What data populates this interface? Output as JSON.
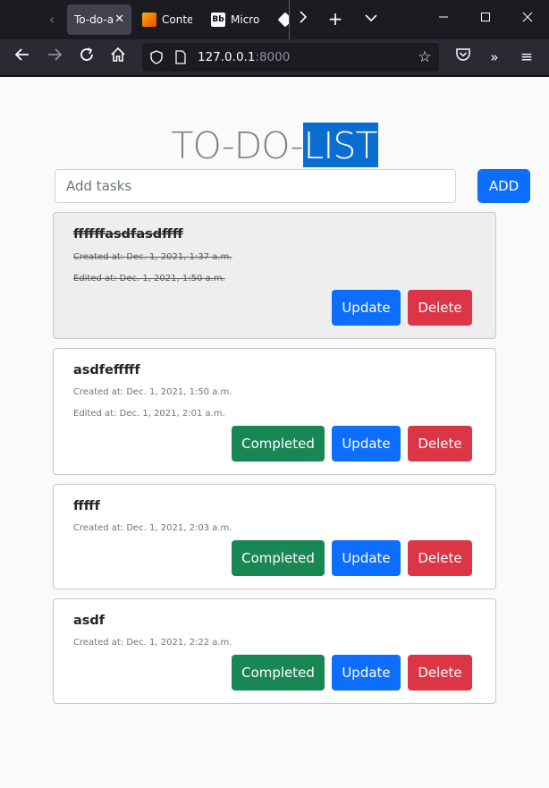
{
  "browser": {
    "tabs": [
      {
        "title": "To-do-a",
        "active": true
      },
      {
        "title": "Conte",
        "active": false
      },
      {
        "title": "Micro",
        "active": false
      },
      {
        "title": "",
        "active": false
      }
    ],
    "window_controls": {
      "minimize": "—",
      "maximize": "☐",
      "close": "✕"
    },
    "url_host": "127.0.0.1",
    "url_port": ":8000"
  },
  "page": {
    "title_plain": "TO-DO-",
    "title_selected": "LIST",
    "input_placeholder": "Add tasks",
    "add_label": "ADD"
  },
  "tasks": [
    {
      "title": "ffffffasdfasdffff",
      "created": "Created at: Dec. 1, 2021, 1:37 a.m.",
      "edited": "Edited at: Dec. 1, 2021, 1:50 a.m.",
      "completed": true,
      "update_label": "Update",
      "delete_label": "Delete"
    },
    {
      "title": "asdfefffff",
      "created": "Created at: Dec. 1, 2021, 1:50 a.m.",
      "edited": "Edited at: Dec. 1, 2021, 2:01 a.m.",
      "completed": false,
      "completed_label": "Completed",
      "update_label": "Update",
      "delete_label": "Delete"
    },
    {
      "title": "fffff",
      "created": "Created at: Dec. 1, 2021, 2:03 a.m.",
      "completed": false,
      "completed_label": "Completed",
      "update_label": "Update",
      "delete_label": "Delete"
    },
    {
      "title": "asdf",
      "created": "Created at: Dec. 1, 2021, 2:22 a.m.",
      "completed": false,
      "completed_label": "Completed",
      "update_label": "Update",
      "delete_label": "Delete"
    }
  ],
  "colors": {
    "primary": "#0d6efd",
    "success": "#198754",
    "danger": "#dc3545",
    "selection": "#0a6ed1"
  }
}
